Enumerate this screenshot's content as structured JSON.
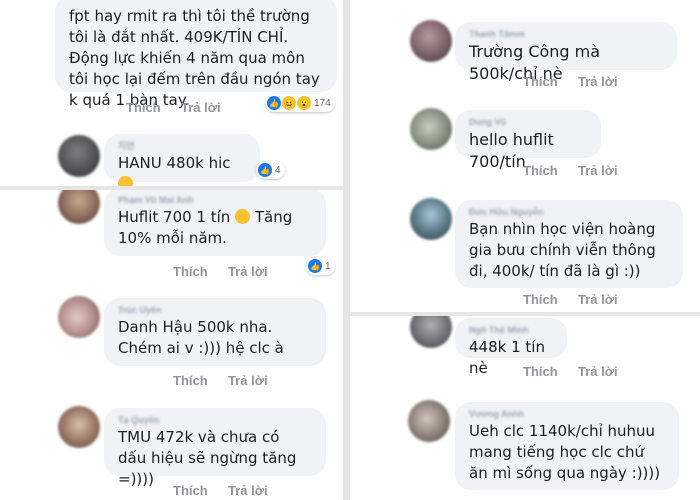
{
  "comments": [
    {
      "id": "c1",
      "name": "",
      "text": "fpt hay rmit ra thì tôi thề trường tôi là đắt nhất. 409K/TÍN CHỈ. Động lực khiến 4 năm qua môn tôi học lại đếm trên đầu ngón tay k quá 1 bàn tay.",
      "like": "Thích",
      "reply": "Trả lời",
      "reaction_count": "174"
    },
    {
      "id": "c2",
      "name": "지연",
      "text": "HANU 480k hic",
      "reaction_count": "4"
    },
    {
      "id": "c3",
      "name": "Phạm Vũ Mai Anh",
      "text_before": "Huflit 700 1 tín",
      "text_after": "Tăng 10% mỗi năm.",
      "like": "Thích",
      "reply": "Trả lời",
      "reaction_count": "1"
    },
    {
      "id": "c4",
      "name": "Trúc Uyên",
      "text": "Danh Hậu 500k nha. Chém ai v :))) hệ clc à",
      "like": "Thích",
      "reply": "Trả lời"
    },
    {
      "id": "c5",
      "name": "Tạ Quyên",
      "text": "TMU 472k và chưa có dấu hiệu sẽ ngừng tăng =))))",
      "like": "Thích",
      "reply": "Trả lời"
    },
    {
      "id": "c6",
      "name": "Thanh Tâmm",
      "text": "Trường Công mà 500k/chỉ nè",
      "like": "Thích",
      "reply": "Trả lời"
    },
    {
      "id": "c7",
      "name": "Dung Vũ",
      "text": "hello huflit 700/tín",
      "like": "Thích",
      "reply": "Trả lời"
    },
    {
      "id": "c8",
      "name": "Đức Hữu Nguyễn",
      "text": "Bạn nhìn học viện hoàng gia bưu chính viễn thông đi, 400k/ tín đã là gì :))",
      "like": "Thích",
      "reply": "Trả lời"
    },
    {
      "id": "c9",
      "name": "Ngô Thế Minh",
      "text": "448k 1 tín nè",
      "like": "Thích",
      "reply": "Trả lời"
    },
    {
      "id": "c10",
      "name": "Vương Anhh",
      "text": "Ueh clc 1140k/chỉ huhuu mang tiếng học clc chứ ăn mì sống qua ngày :))))",
      "like": "Thích",
      "reply": "Trả lời"
    }
  ],
  "colors": {
    "bubble": "#f0f2f5",
    "like_blue": "#1877f2",
    "action_gray": "#90949c",
    "name_gray": "#9aa5b8"
  }
}
